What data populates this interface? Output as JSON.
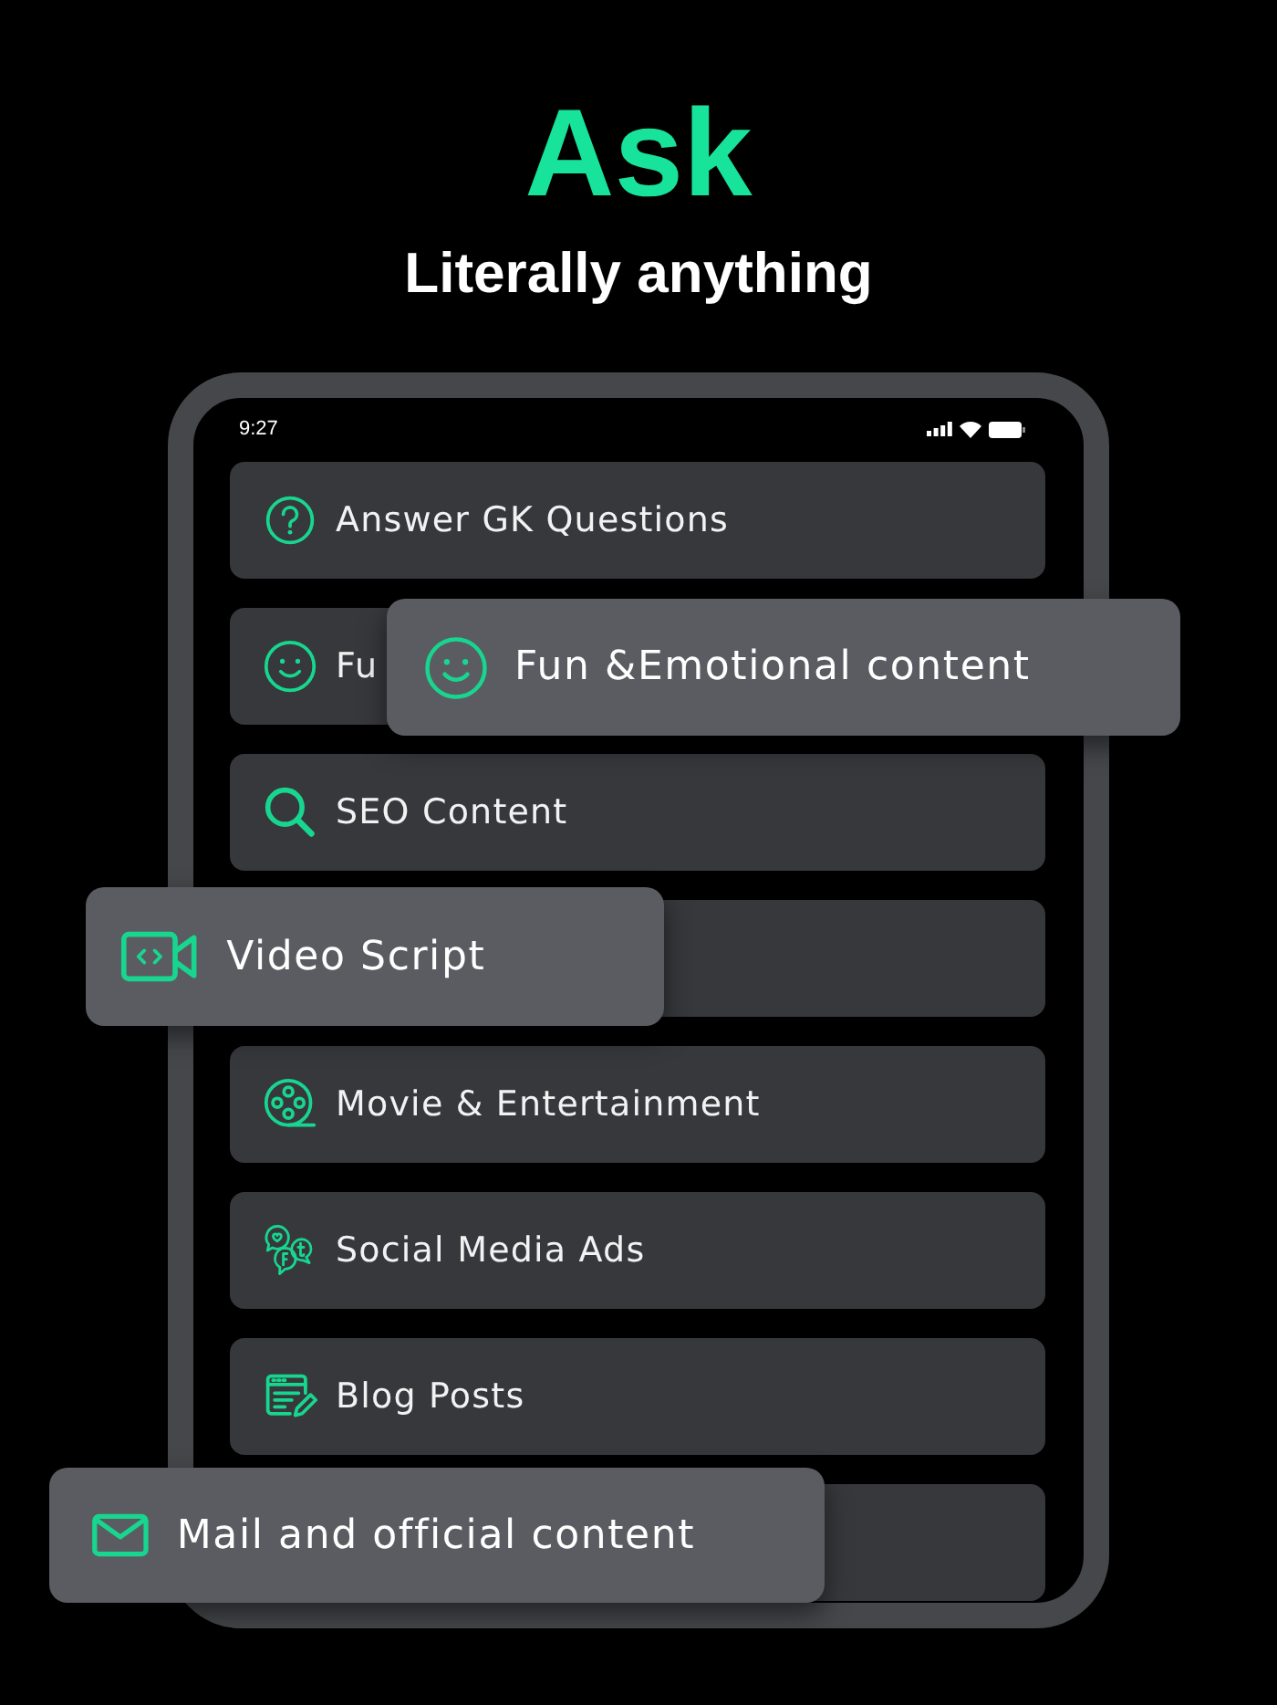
{
  "heading": {
    "title": "Ask",
    "subtitle": "Literally anything"
  },
  "phone": {
    "status_bar": {
      "time": "9:27"
    },
    "rows": [
      {
        "kind": "question",
        "label": "Answer GK Questions"
      },
      {
        "kind": "smile",
        "label": "Fu"
      },
      {
        "kind": "search",
        "label": "SEO Content"
      },
      {
        "kind": "blank"
      },
      {
        "kind": "movie",
        "label": "Movie & Entertainment"
      },
      {
        "kind": "social",
        "label": "Social Media Ads"
      },
      {
        "kind": "blog",
        "label": "Blog Posts"
      },
      {
        "kind": "blank"
      }
    ]
  },
  "popout_cards": [
    {
      "kind": "smile",
      "label": "Fun &Emotional content"
    },
    {
      "kind": "video",
      "label": "Video Script"
    },
    {
      "kind": "mail",
      "label": "Mail and official content"
    }
  ]
}
